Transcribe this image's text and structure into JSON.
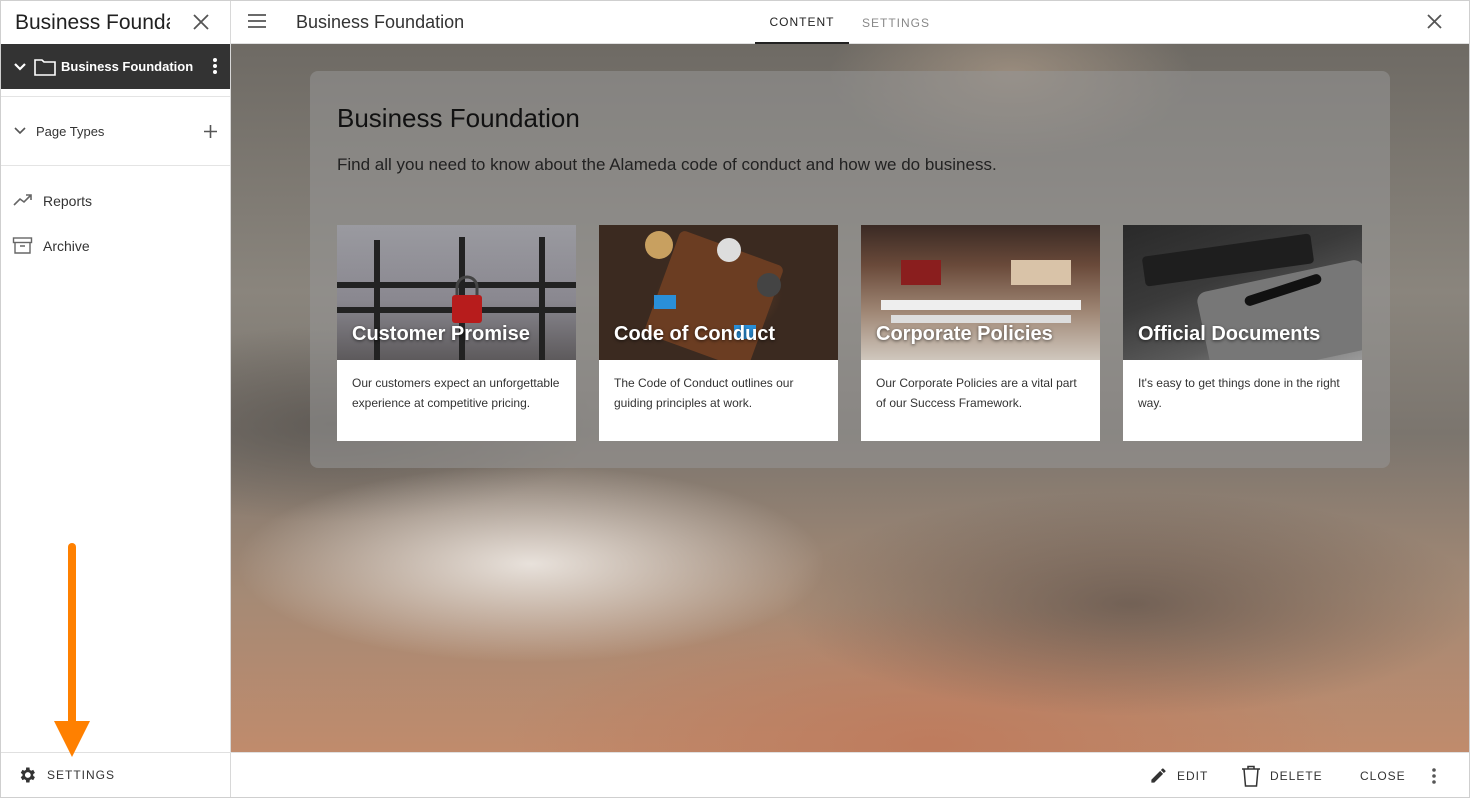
{
  "left_panel": {
    "title": "Business Foundation",
    "folder": {
      "name": "Business Foundation"
    },
    "page_types": {
      "label": "Page Types"
    },
    "nav": [
      {
        "label": "Reports",
        "icon": "trending-up-icon"
      },
      {
        "label": "Archive",
        "icon": "archive-box-icon"
      }
    ],
    "footer": {
      "settings_label": "SETTINGS"
    }
  },
  "topbar": {
    "title": "Business Foundation",
    "tabs": [
      {
        "label": "CONTENT",
        "active": true
      },
      {
        "label": "SETTINGS",
        "active": false
      }
    ]
  },
  "main": {
    "hero": {
      "title": "Business Foundation",
      "subtitle": "Find all you need to know about the Alameda code of conduct and how we do business."
    },
    "cards": [
      {
        "title": "Customer Promise",
        "description": "Our customers expect an unforgettable experience at competitive pricing."
      },
      {
        "title": "Code of Conduct",
        "description": "The Code of Conduct outlines our guiding principles at work."
      },
      {
        "title": "Corporate Policies",
        "description": "Our Corporate Policies are a vital part of our Success Framework."
      },
      {
        "title": "Official Documents",
        "description": "It's easy to get things done in the right way."
      }
    ]
  },
  "bottombar": {
    "edit_label": "EDIT",
    "delete_label": "DELETE",
    "close_label": "CLOSE"
  },
  "colors": {
    "sidebar_folder_bg": "#333333",
    "annotation_arrow": "#ff8000",
    "text_primary": "#222222",
    "tab_inactive": "#888888"
  }
}
